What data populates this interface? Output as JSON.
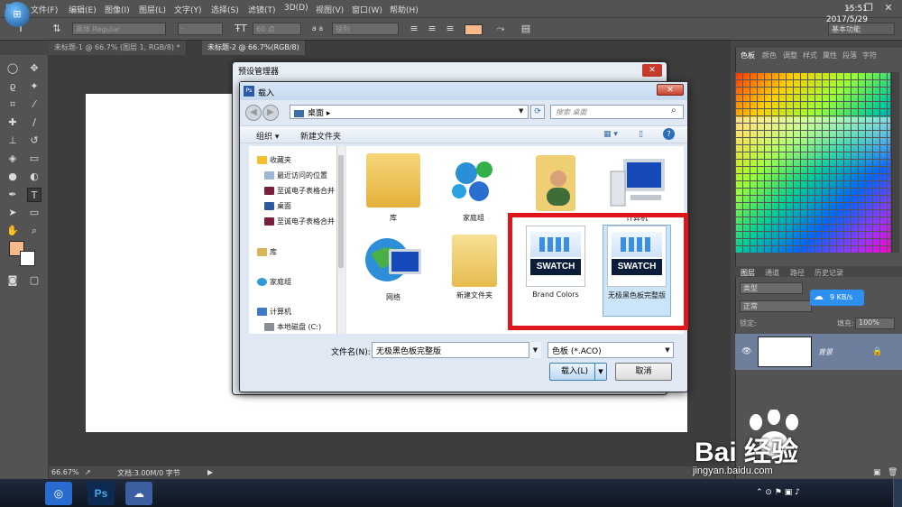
{
  "app": {
    "logo": "Ps",
    "menu": [
      "文件(F)",
      "编辑(E)",
      "图像(I)",
      "图层(L)",
      "文字(Y)",
      "选择(S)",
      "滤镜(T)",
      "3D(D)",
      "视图(V)",
      "窗口(W)",
      "帮助(H)"
    ],
    "workspace": "基本功能"
  },
  "options": {
    "font_family": "黑体 Regular",
    "font_style": "-",
    "font_size": "60 点",
    "aa": "锐利",
    "aa_label": "a a",
    "text_color": "#f7b98a"
  },
  "doc_tabs": [
    {
      "label": "未标题-1 @ 66.7% (图层 1, RGB/8) *"
    },
    {
      "label": "未标题-2 @ 66.7%(RGB/8)"
    }
  ],
  "status": {
    "zoom": "66.67%",
    "doc": "文档:3.00M/0 字节"
  },
  "preset_manager": {
    "title": "预设管理器"
  },
  "dialog": {
    "title": "载入",
    "address": "桌面",
    "search_placeholder": "搜索 桌面",
    "cmd_organize": "组织",
    "cmd_new_folder": "新建文件夹",
    "nav": {
      "favorites": "收藏夹",
      "recent": "最近访问的位置",
      "fav1": "至诚电子表格合并",
      "desktop": "桌面",
      "fav2": "至诚电子表格合并",
      "library": "库",
      "homegroup": "家庭组",
      "computer": "计算机",
      "local_disk": "本地磁盘 (C:)"
    },
    "files": {
      "f1": "库",
      "f2": "家庭组",
      "f3": "",
      "f4": "计算机",
      "f5": "网络",
      "f6": "新建文件夹",
      "f7": "Brand Colors",
      "f8": "无极黑色板完整版",
      "swatch_word": "SWATCH"
    },
    "filename_label": "文件名(N):",
    "filename_value": "无极黑色板完整版",
    "filetype_value": "色板 (*.ACO)",
    "btn_load": "载入(L)",
    "btn_cancel": "取消"
  },
  "right_panel": {
    "tabs": [
      "色板",
      "颜色",
      "调整",
      "样式",
      "属性",
      "段落",
      "字符"
    ],
    "layers_tabs": [
      "图层",
      "通道",
      "路径",
      "历史记录"
    ],
    "kind": "类型",
    "blend": "正常",
    "lock_label": "锁定:",
    "fill_label": "填充:",
    "fill_value": "100%",
    "layer_name": "背景"
  },
  "net_badge": "9 KB/s",
  "taskbar": {
    "ps": "Ps",
    "time": "15:51",
    "date": "2017/5/29"
  },
  "watermark": {
    "text": "Bai 经验",
    "url": "jingyan.baidu.com"
  },
  "colors": {
    "highlight_box": "#e0161d",
    "ps_blue": "#4aa8e8"
  }
}
